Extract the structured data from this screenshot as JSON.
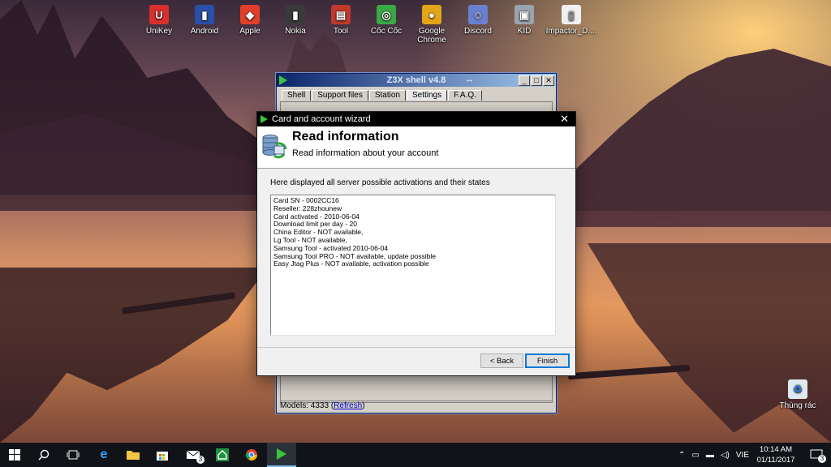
{
  "desktop": {
    "icons": [
      {
        "label": "UniKey",
        "color": "#d9302c",
        "glyph": "U"
      },
      {
        "label": "Android",
        "color": "#2a4fa8",
        "glyph": "▮"
      },
      {
        "label": "Apple",
        "color": "#e0402a",
        "glyph": "◆"
      },
      {
        "label": "Nokia",
        "color": "#3a3a3a",
        "glyph": "▮"
      },
      {
        "label": "Tool",
        "color": "#c0392b",
        "glyph": "▤"
      },
      {
        "label": "Cốc Cốc",
        "color": "#3aa845",
        "glyph": "◎"
      },
      {
        "label": "Google Chrome",
        "color": "#e2a51a",
        "glyph": "●"
      },
      {
        "label": "Discord",
        "color": "#6b7fd1",
        "glyph": "☺"
      },
      {
        "label": "KID",
        "color": "#9aa4ad",
        "glyph": "▣"
      },
      {
        "label": "Impactor_D....",
        "color": "#f0f0f0",
        "glyph": "▯"
      }
    ],
    "recycle_bin": {
      "label": "Thùng rác"
    }
  },
  "z3x_window": {
    "title": "Z3X shell v4.8",
    "arrows": "↔",
    "tabs": [
      "Shell",
      "Support files",
      "Station",
      "Settings",
      "F.A.Q."
    ],
    "active_tab": "Settings",
    "status_models": "Models: 4333",
    "status_refresh": "Refresh"
  },
  "wizard": {
    "title": "Card and account wizard",
    "close_glyph": "✕",
    "heading": "Read information",
    "subheading": "Read information about your account",
    "description": "Here displayed all server possible activations and their states",
    "info_lines": [
      "Card SN - 0002CC16",
      "Reseller: 228zhounew",
      "Card activated - 2010-06-04",
      "Download limit per day - 20",
      "China Editor - NOT available,",
      "Lg Tool - NOT available,",
      "Samsung Tool - activated 2010-06-04",
      "Samsung Tool PRO - NOT available, update possible",
      "Easy Jtag Plus - NOT available, activation possible"
    ],
    "back_label": "< Back",
    "finish_label": "Finish"
  },
  "taskbar": {
    "language": "VIE",
    "time": "10:14 AM",
    "date": "01/11/2017",
    "notification_count": "3",
    "mail_badge": "3"
  }
}
